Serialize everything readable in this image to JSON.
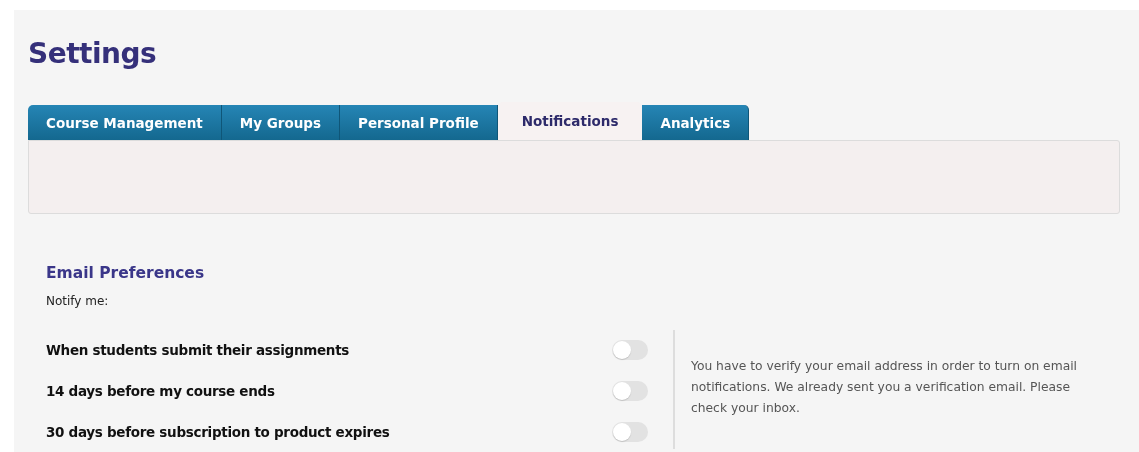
{
  "page": {
    "title": "Settings"
  },
  "tabs": [
    {
      "label": "Course Management",
      "selected": false
    },
    {
      "label": "My Groups",
      "selected": false
    },
    {
      "label": "Personal Profile",
      "selected": false
    },
    {
      "label": "Notifications",
      "selected": true
    },
    {
      "label": "Analytics",
      "selected": false
    }
  ],
  "email_preferences": {
    "heading": "Email Preferences",
    "intro": "Notify me:",
    "options": [
      {
        "label": "When students submit their assignments",
        "on": false
      },
      {
        "label": "14 days before my course ends",
        "on": false
      },
      {
        "label": "30 days before subscription to product expires",
        "on": false
      }
    ],
    "note": "You have to verify your email address in order to turn on email notifications. We already sent you a verification email. Please check your inbox."
  }
}
